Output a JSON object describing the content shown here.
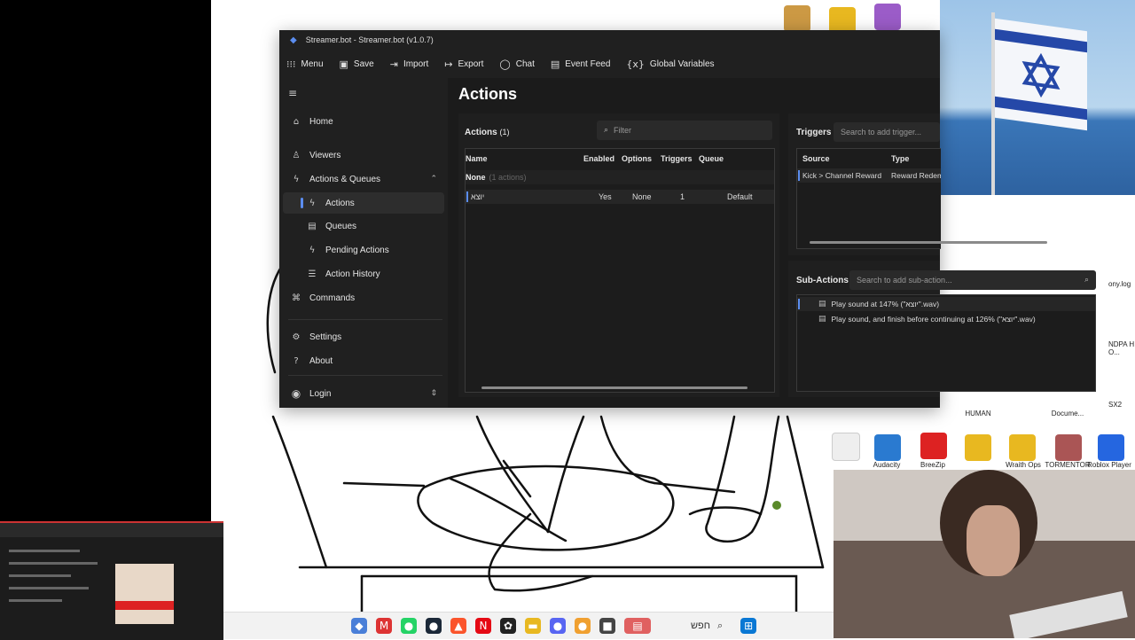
{
  "window": {
    "title": "Streamer.bot - Streamer.bot (v1.0.7)"
  },
  "toolbar": {
    "menu": "Menu",
    "save": "Save",
    "import": "Import",
    "export": "Export",
    "chat": "Chat",
    "event_feed": "Event Feed",
    "global_variables": "Global Variables"
  },
  "sidebar": {
    "home": "Home",
    "viewers": "Viewers",
    "actions_queues": "Actions & Queues",
    "actions": "Actions",
    "queues": "Queues",
    "pending_actions": "Pending Actions",
    "action_history": "Action History",
    "commands": "Commands",
    "settings": "Settings",
    "about": "About",
    "login": "Login"
  },
  "main": {
    "page_title": "Actions",
    "actions_panel": {
      "title": "Actions",
      "count": "(1)",
      "filter_placeholder": "Filter",
      "columns": [
        "Name",
        "Enabled",
        "Options",
        "Triggers",
        "Queue"
      ],
      "group_name": "None",
      "group_count": "(1 actions)",
      "rows": [
        {
          "name": "יוצא",
          "enabled": "Yes",
          "options": "None",
          "triggers": "1",
          "queue": "Default"
        }
      ]
    },
    "triggers_panel": {
      "title": "Triggers",
      "search_placeholder": "Search to add trigger...",
      "columns": [
        "Source",
        "Type"
      ],
      "rows": [
        {
          "source": "Kick > Channel Reward",
          "type": "Reward Redem"
        }
      ]
    },
    "subactions_panel": {
      "title": "Sub-Actions",
      "search_placeholder": "Search to add sub-action...",
      "items": [
        "Play sound at 147% (\"יוצא\".wav)",
        "Play sound, and finish before continuing at 126% (\"יוצא\".wav)"
      ]
    }
  },
  "desktop": {
    "labels": [
      "Audacity",
      "BreeZip",
      "Wraith Ops",
      "TORMENTOR",
      "Roblox Player",
      "HUMAN",
      "Docume...",
      "NDPA H O...",
      "SX2",
      "ony.log"
    ]
  },
  "taskbar": {
    "search_label": "חפש"
  },
  "colors": {
    "accent": "#5b8def",
    "window_bg": "#202020",
    "panel_bg": "#1f1f1f"
  }
}
